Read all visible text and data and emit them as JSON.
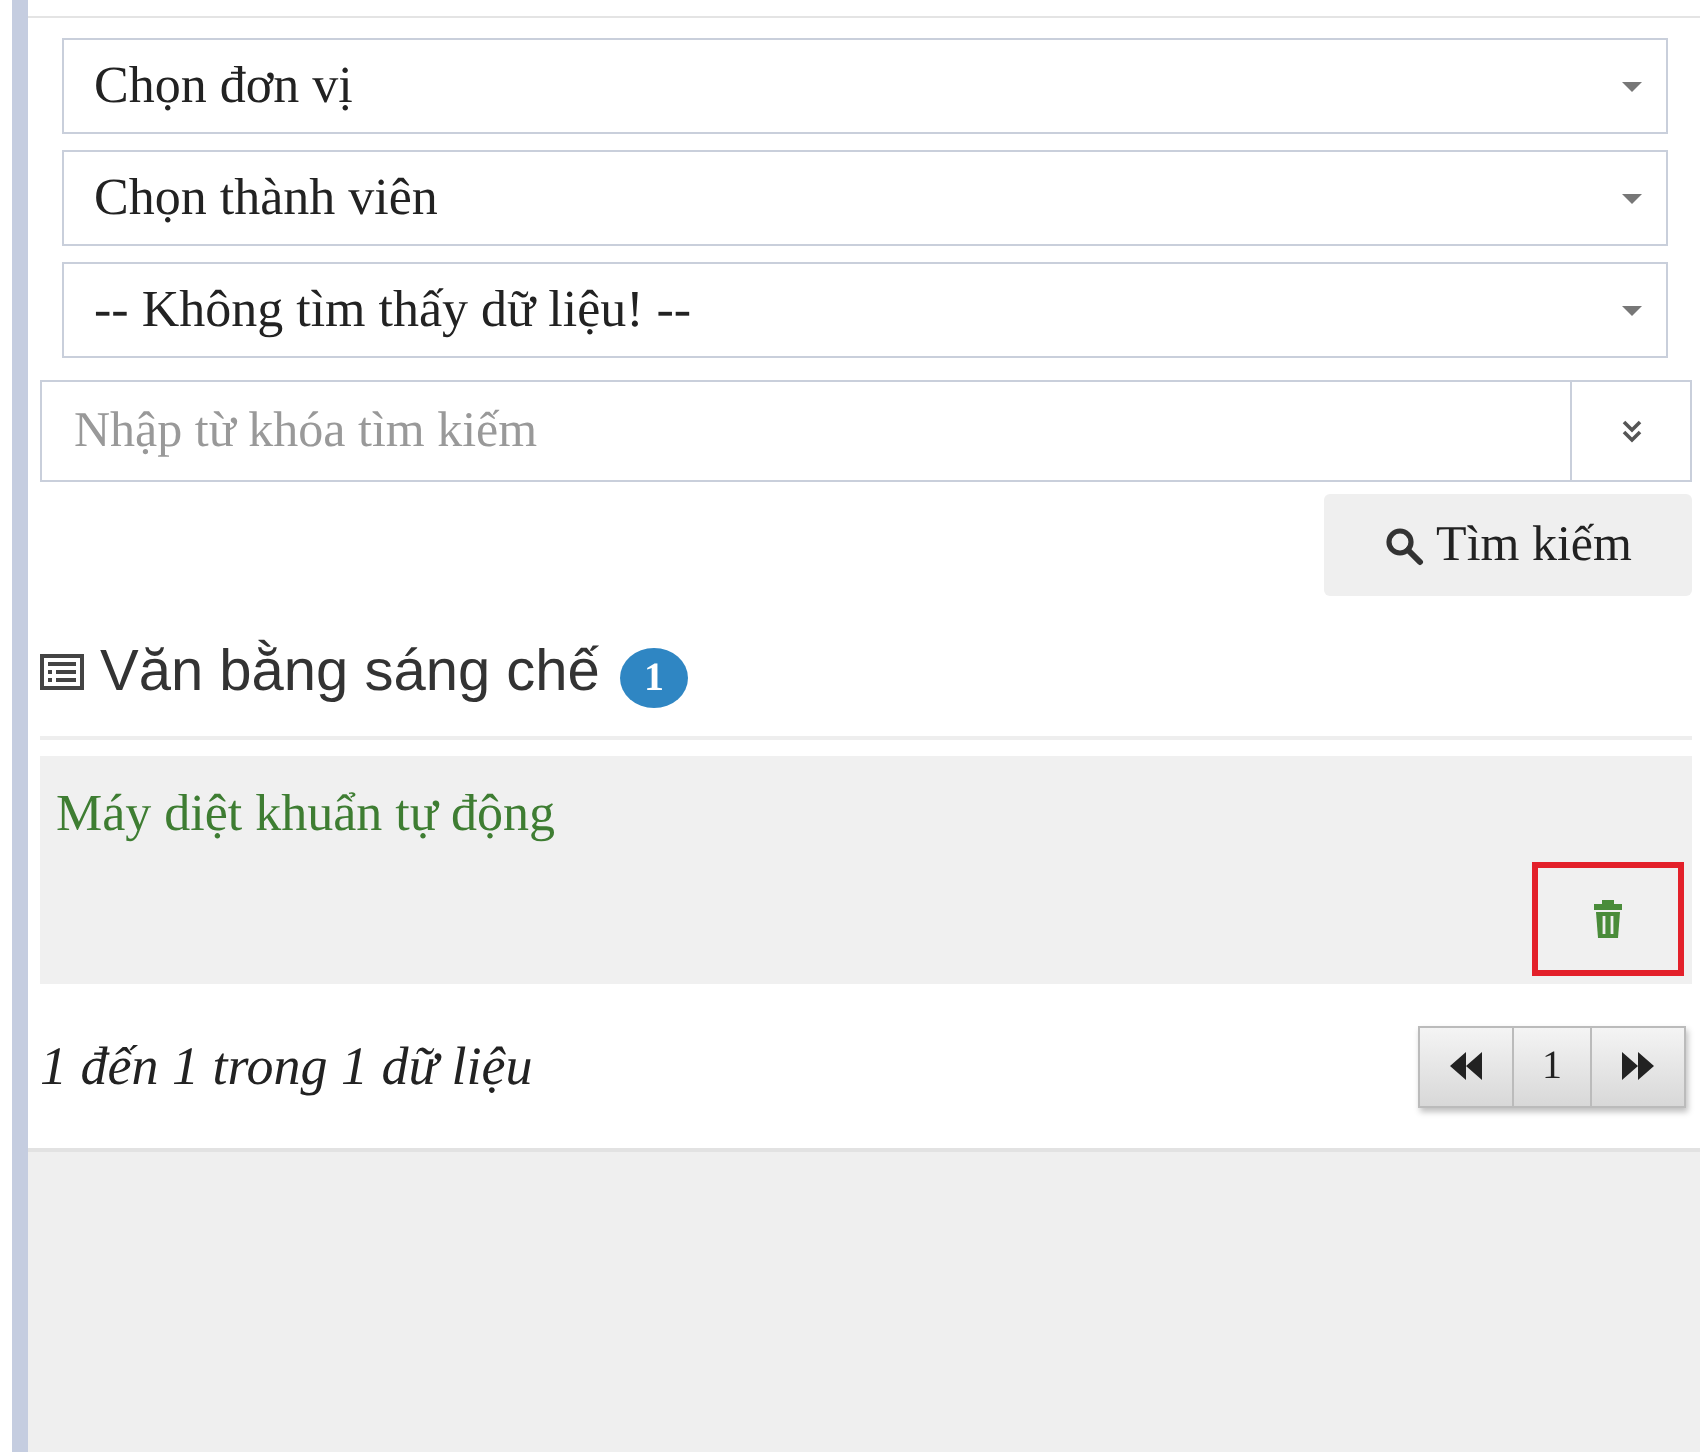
{
  "filters": [
    {
      "value": "Chọn đơn vị"
    },
    {
      "value": "Chọn thành viên"
    },
    {
      "value": "-- Không tìm thấy dữ liệu! --"
    }
  ],
  "search": {
    "placeholder": "Nhập từ khóa tìm kiếm",
    "button": "Tìm kiếm"
  },
  "section": {
    "title": "Văn bằng sáng chế",
    "count": "1"
  },
  "items": [
    {
      "title": "Máy diệt khuẩn tự động",
      "delete_highlighted": true
    }
  ],
  "pagination": {
    "summary": "1 đến 1 trong 1 dữ liệu",
    "pages": [
      {
        "label": "1",
        "selected": false
      }
    ]
  }
}
